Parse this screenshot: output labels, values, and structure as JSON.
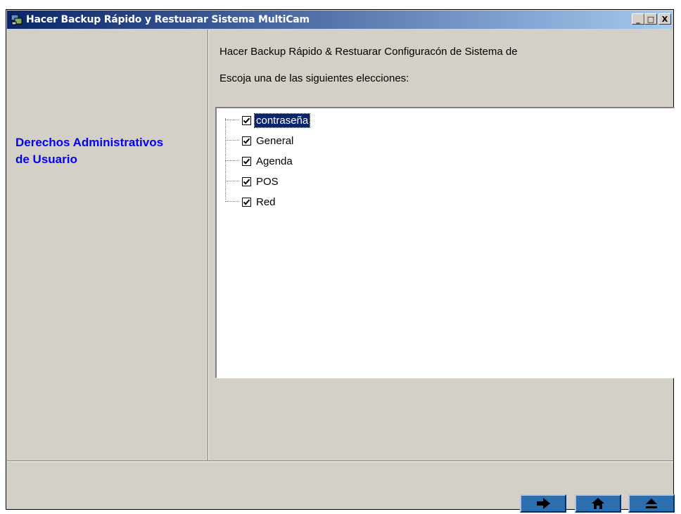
{
  "window": {
    "title": "Hacer Backup Rápido y Restuarar Sistema MultiCam",
    "controls": {
      "minimize": "_",
      "maximize": "□",
      "close": "X"
    }
  },
  "sidebar": {
    "section_title": "Derechos Administrativos de Usuario"
  },
  "main": {
    "header_line1": "Hacer Backup Rápido & Restuarar Configuracón de Sistema de",
    "header_line2": "Escoja una de las siguientes elecciones:",
    "tree_items": [
      {
        "label": "contraseña",
        "checked": true,
        "selected": true
      },
      {
        "label": "General",
        "checked": true,
        "selected": false
      },
      {
        "label": "Agenda",
        "checked": true,
        "selected": false
      },
      {
        "label": "POS",
        "checked": true,
        "selected": false
      },
      {
        "label": "Red",
        "checked": true,
        "selected": false
      }
    ]
  },
  "footer": {
    "buttons": [
      {
        "icon": "arrow-right-icon"
      },
      {
        "icon": "home-icon"
      },
      {
        "icon": "eject-icon"
      }
    ]
  },
  "colors": {
    "title_gradient_start": "#0a246a",
    "title_gradient_end": "#a6caf0",
    "section_title": "#0000ff",
    "window_bg": "#d4d0c8",
    "nav_button": "#2c6fae"
  }
}
